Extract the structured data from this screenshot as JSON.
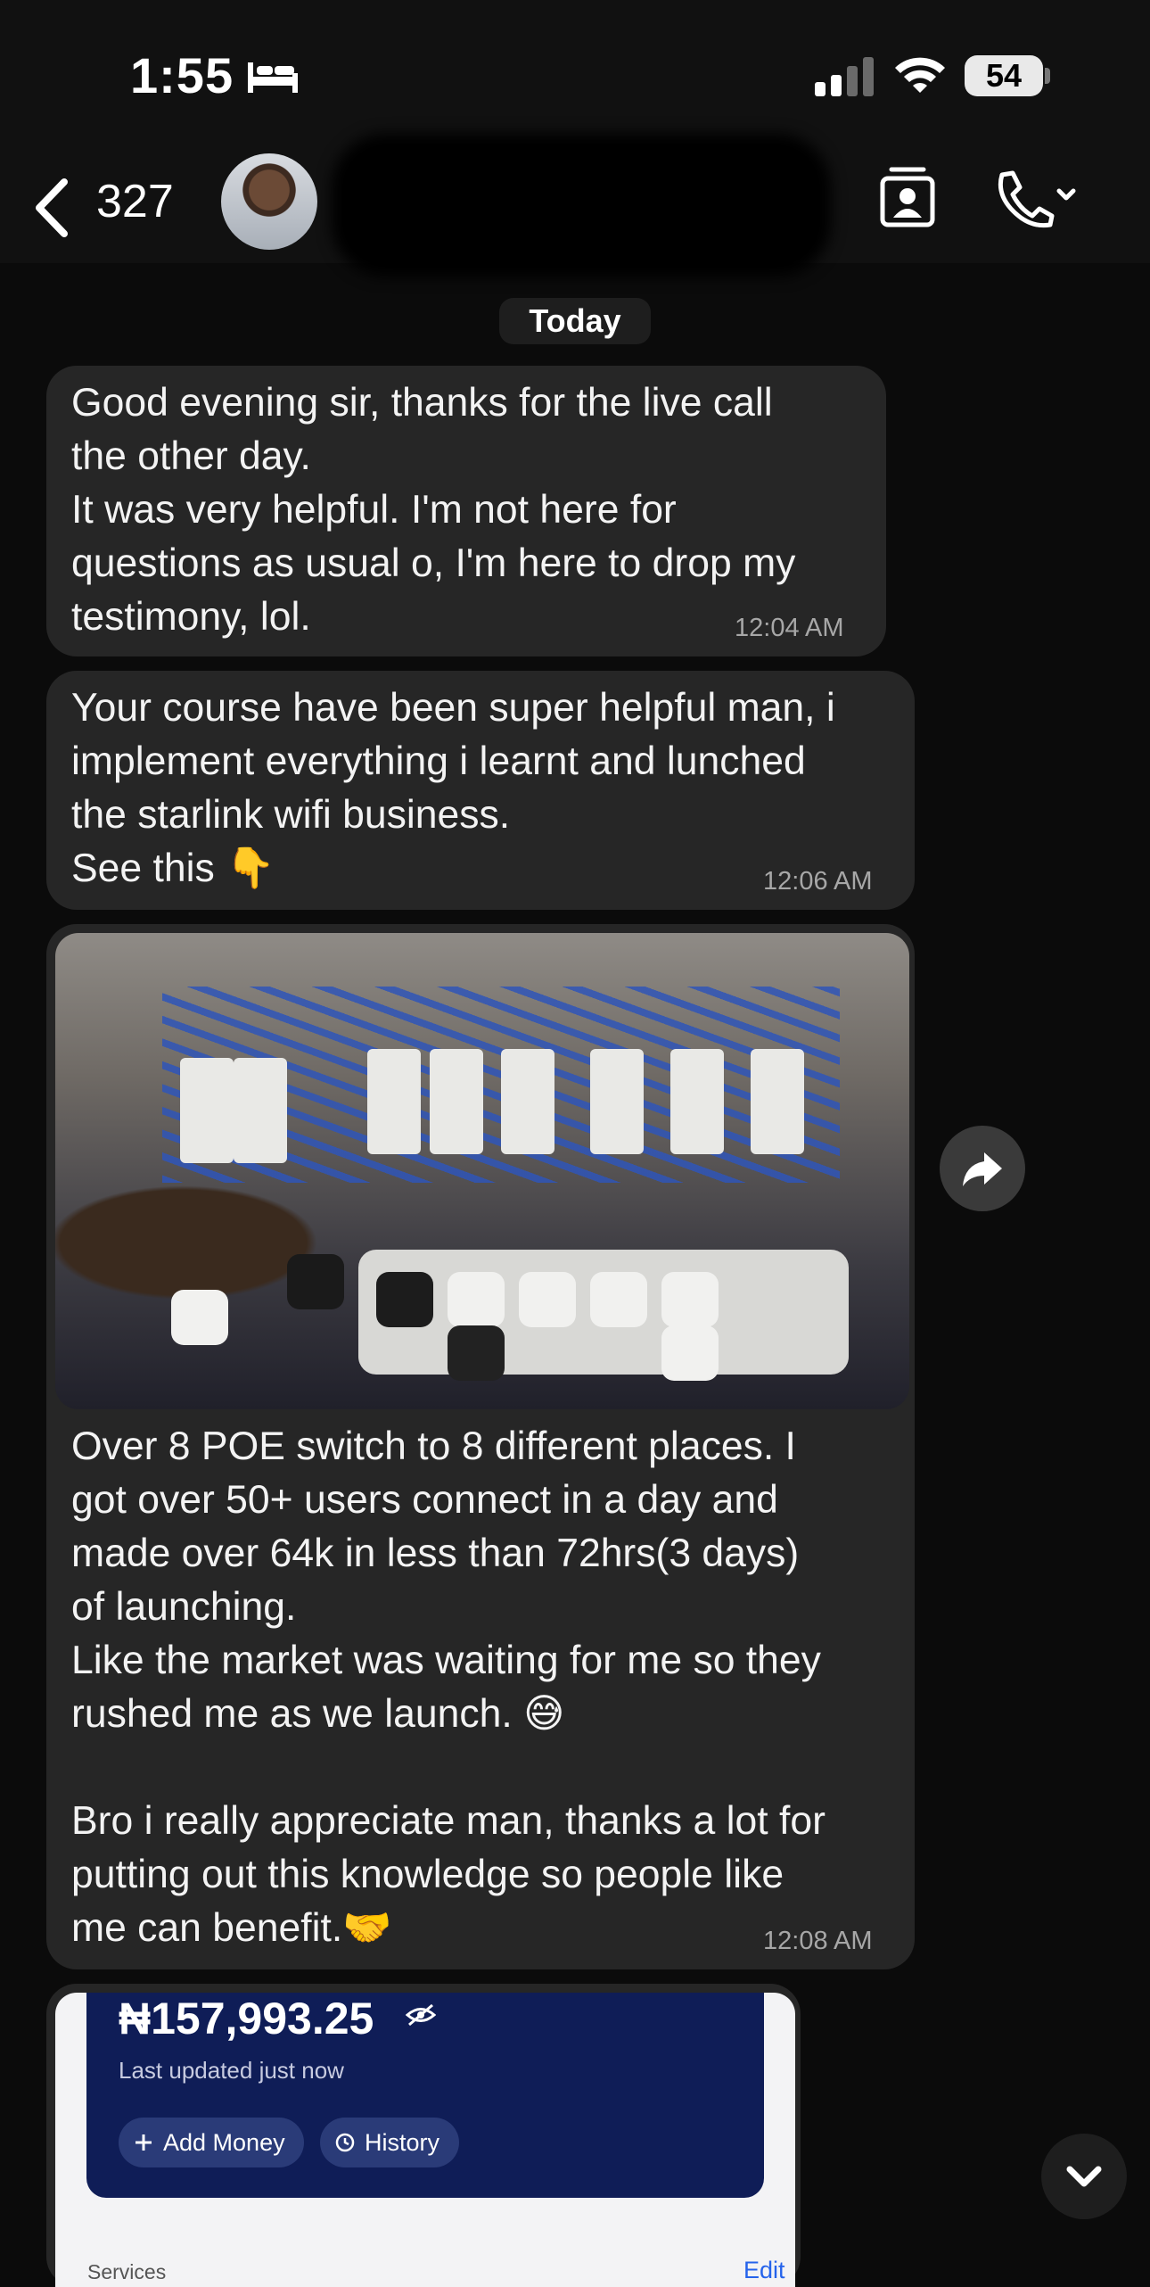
{
  "status_bar": {
    "time": "1:55",
    "battery": "54"
  },
  "header": {
    "back_count": "327"
  },
  "date_separator": "Today",
  "messages": [
    {
      "text": "Good evening sir, thanks for the live call\nthe other day.\nIt was very helpful. I'm not here for\nquestions as usual o, I'm here to drop my\ntestimony, lol.",
      "time": "12:04 AM"
    },
    {
      "text": "Your course have been super helpful man, i\nimplement everything i learnt and lunched\nthe starlink wifi business.\nSee this 👇",
      "time": "12:06 AM"
    },
    {
      "text": "Over 8 POE switch to 8 different places. I\ngot over 50+ users connect in a day and\nmade over 64k in less than 72hrs(3 days)\nof launching.\nLike the market was waiting for me so they\nrushed me as we launch. 😅\n\nBro i really appreciate man, thanks a lot for\nputting out this knowledge so people like\nme can benefit.🤝",
      "time": "12:08 AM"
    }
  ],
  "screenshot_message": {
    "balance": "₦157,993.25",
    "updated": "Last updated just now",
    "add_money": "Add Money",
    "history": "History",
    "services": "Services",
    "edit": "Edit"
  }
}
